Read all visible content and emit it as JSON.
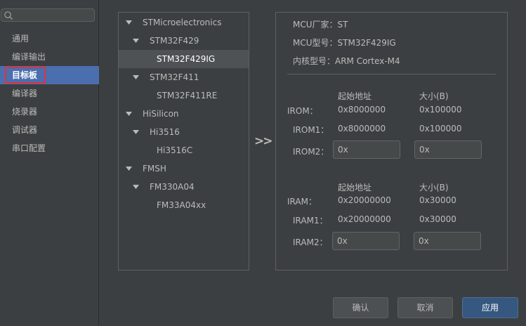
{
  "sidebar": {
    "search_placeholder": "",
    "items": [
      {
        "label": "通用"
      },
      {
        "label": "编译输出"
      },
      {
        "label": "目标板"
      },
      {
        "label": "编译器"
      },
      {
        "label": "烧录器"
      },
      {
        "label": "调试器"
      },
      {
        "label": "串口配置"
      }
    ],
    "selected_index": 2
  },
  "tree": {
    "items": [
      {
        "label": "STMicroelectronics",
        "level": 0,
        "expanded": true
      },
      {
        "label": "STM32F429",
        "level": 1,
        "expanded": true
      },
      {
        "label": "STM32F429IG",
        "level": 2,
        "selected": true
      },
      {
        "label": "STM32F411",
        "level": 1,
        "expanded": true
      },
      {
        "label": "STM32F411RE",
        "level": 2
      },
      {
        "label": "HiSilicon",
        "level": 0,
        "expanded": true
      },
      {
        "label": "Hi3516",
        "level": 1,
        "expanded": true
      },
      {
        "label": "Hi3516C",
        "level": 2
      },
      {
        "label": "FMSH",
        "level": 0,
        "expanded": true
      },
      {
        "label": "FM330A04",
        "level": 1,
        "expanded": true
      },
      {
        "label": "FM33A04xx",
        "level": 2
      }
    ]
  },
  "transfer_label": ">>",
  "info": {
    "vendor": "MCU厂家：ST",
    "model": "MCU型号：STM32F429IG",
    "core": "内核型号：ARM Cortex-M4",
    "rom": {
      "header_start": "起始地址",
      "header_size": "大小(B)",
      "group_label": "IROM：",
      "rows": [
        {
          "label": "",
          "start": "0x8000000",
          "size": "0x100000"
        },
        {
          "label": "IROM1：",
          "start": "0x8000000",
          "size": "0x100000"
        }
      ],
      "editable": {
        "label": "IROM2：",
        "start": "0x",
        "size": "0x"
      }
    },
    "ram": {
      "header_start": "起始地址",
      "header_size": "大小(B)",
      "group_label": "IRAM：",
      "rows": [
        {
          "label": "",
          "start": "0x20000000",
          "size": "0x30000"
        },
        {
          "label": "IRAM1：",
          "start": "0x20000000",
          "size": "0x30000"
        }
      ],
      "editable": {
        "label": "IRAM2：",
        "start": "0x",
        "size": "0x"
      }
    }
  },
  "buttons": {
    "ok": "确认",
    "cancel": "取消",
    "apply": "应用"
  }
}
